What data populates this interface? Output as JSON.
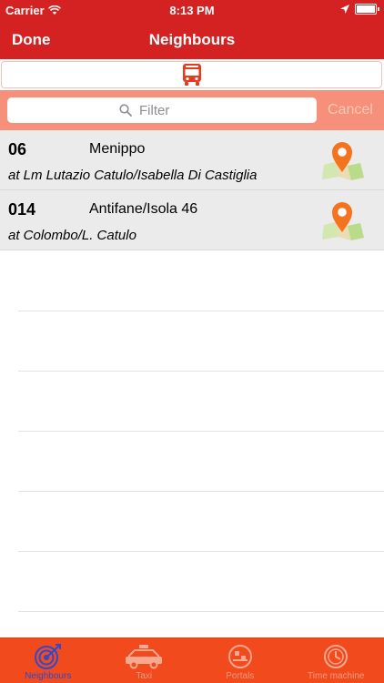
{
  "status_bar": {
    "carrier": "Carrier",
    "time": "8:13 PM"
  },
  "nav": {
    "done_label": "Done",
    "title": "Neighbours"
  },
  "segment": {
    "icon": "bus-icon"
  },
  "search": {
    "placeholder": "Filter",
    "value": "",
    "cancel_label": "Cancel"
  },
  "stops": [
    {
      "code": "06",
      "name": "Menippo",
      "stop": "at Lm Lutazio Catulo/Isabella Di Castiglia",
      "icon": "map-pin-icon"
    },
    {
      "code": "014",
      "name": "Antifane/Isola 46",
      "stop": "at Colombo/L. Catulo",
      "icon": "map-pin-icon"
    }
  ],
  "tabs": [
    {
      "label": "Neighbours",
      "icon": "target-icon",
      "active": true
    },
    {
      "label": "Taxi",
      "icon": "taxi-icon",
      "active": false
    },
    {
      "label": "Portals",
      "icon": "portal-icon",
      "active": false
    },
    {
      "label": "Time machine",
      "icon": "clock-icon",
      "active": false
    }
  ],
  "colors": {
    "header": "#d42121",
    "search_bar": "#f6907a",
    "tab_bar": "#f04a1d",
    "active_tab": "#2c4bd1",
    "inactive_tab": "#f59b80",
    "bus_icon": "#e53a1e"
  }
}
